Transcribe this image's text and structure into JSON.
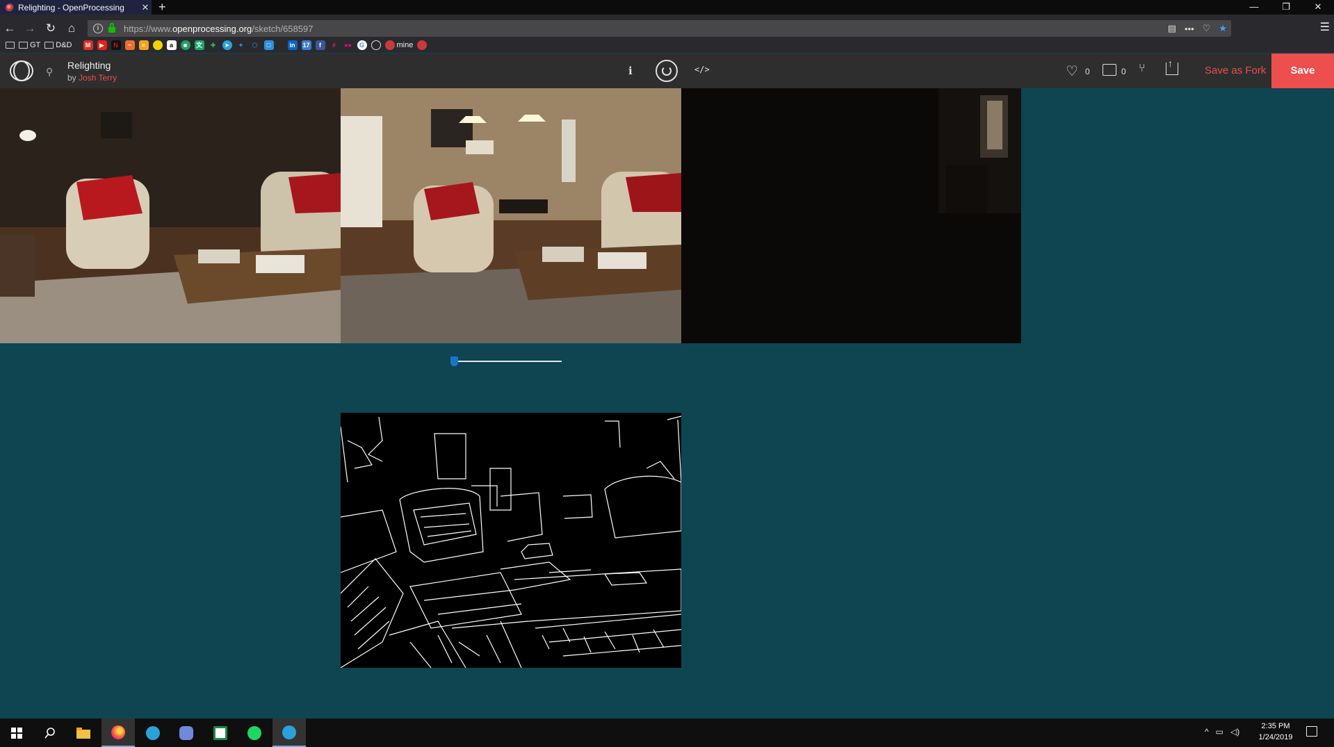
{
  "browser": {
    "tab_title": "Relighting - OpenProcessing",
    "tab_close": "✕",
    "new_tab": "+",
    "url_prefix": "https://www.",
    "url_domain": "openprocessing.org",
    "url_path": "/sketch/658597",
    "window_minimize": "—",
    "window_restore": "❐",
    "window_close": "✕",
    "bookmarks": {
      "folders": [
        "GT",
        "D&D"
      ],
      "named_bookmark": "mine",
      "icons": [
        "gmail-icon",
        "youtube-icon",
        "netflix-icon",
        "feedly-icon",
        "sunrise-icon",
        "keep-icon",
        "amazon-icon",
        "classroom-icon",
        "translate-icon",
        "sprout-icon",
        "telegram-icon",
        "twitter-icon",
        "cube-icon",
        "box-icon",
        "linkedin-icon",
        "calendar-icon",
        "facebook-icon",
        "slack-icon",
        "flickr-icon",
        "chrome-icon",
        "globe-icon",
        "openprocessing-icon"
      ]
    }
  },
  "sketch": {
    "title": "Relighting",
    "by_prefix": "by",
    "author": "Josh Terry",
    "info_label": "i",
    "code_label": "</>",
    "likes": "0",
    "comments": "0",
    "save_as_fork_label": "Save as Fork",
    "save_label": "Save",
    "slider_value": 0.0
  },
  "taskbar": {
    "time": "2:35 PM",
    "date": "1/24/2019",
    "apps": [
      "start-icon",
      "search-icon",
      "file-explorer-icon",
      "firefox-icon",
      "telegram-icon",
      "discord-icon",
      "sway-icon",
      "spotify-icon",
      "telegram-icon"
    ]
  },
  "colors": {
    "canvas_bg": "#0f4551",
    "accent_red": "#ed4e4e",
    "slider_blue": "#1a75c9",
    "header_bg": "#2e2e2e"
  }
}
